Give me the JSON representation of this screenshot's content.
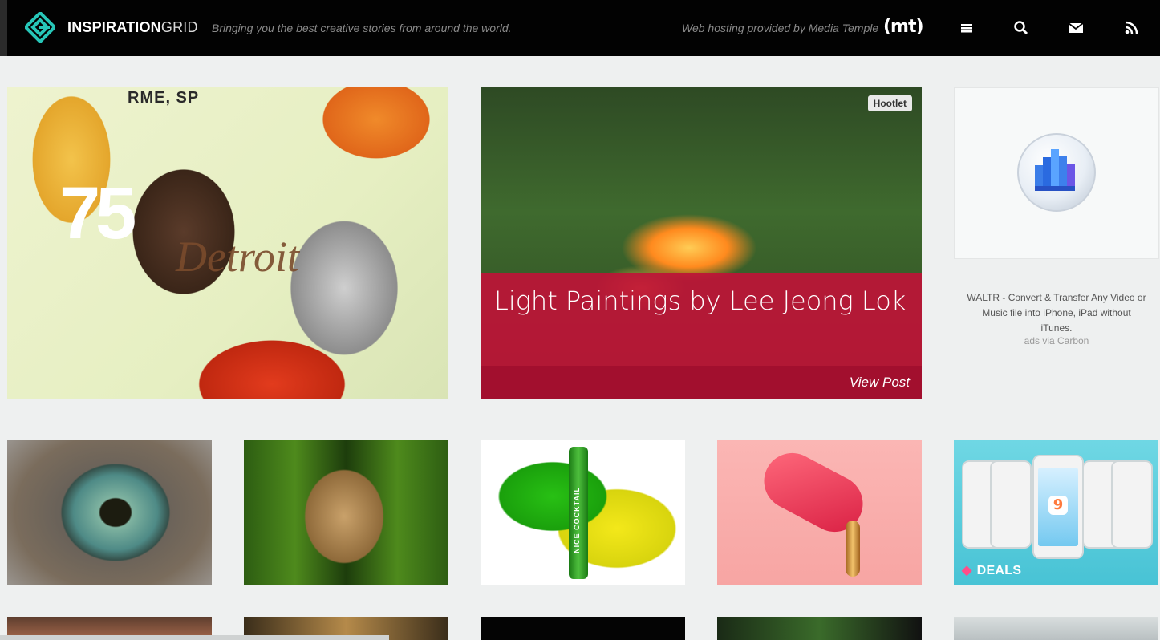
{
  "header": {
    "logo_bold": "INSPIRATION",
    "logo_light": "GRID",
    "tagline": "Bringing you the best creative stories from around the world.",
    "hosting_text": "Web hosting provided by Media Temple",
    "sponsor_logo": "(mt)",
    "icons": [
      "menu-icon",
      "search-icon",
      "mail-icon",
      "rss-icon"
    ],
    "accent_color": "#27c6b8"
  },
  "featured": {
    "artwork_texts": {
      "top": "RME, SP",
      "number": "75",
      "script": "Detroit"
    },
    "post": {
      "title": "Light Paintings by Lee Jeong Lok",
      "cta": "View Post",
      "badge": "Hootlet",
      "overlay_color": "#be1437"
    }
  },
  "ad": {
    "text": "WALTR - Convert & Transfer Any Video or Music file into iPhone, iPad without iTunes.",
    "via": "ads via Carbon"
  },
  "thumbnails": [
    {
      "subject": "cat-eye"
    },
    {
      "subject": "green-hair-portrait"
    },
    {
      "subject": "cocktail-tube",
      "text": "NICE COCKTAIL"
    },
    {
      "subject": "popsicle"
    },
    {
      "subject": "iphone-deals",
      "text": "9",
      "badge": "DEALS"
    }
  ]
}
